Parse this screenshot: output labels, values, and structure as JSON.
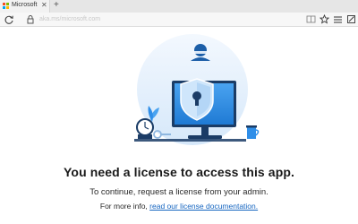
{
  "browser": {
    "tab_title": "Microsoft",
    "tab_close": "✕",
    "new_tab": "+",
    "url": "aka.ms/microsoft.com"
  },
  "icons": {
    "tab_favicon": "microsoft-logo",
    "refresh": "refresh-icon",
    "lock": "lock-icon",
    "reading_view": "reading-view-icon",
    "favorite": "star-icon",
    "hub": "hub-icon",
    "notes": "notes-icon"
  },
  "message": {
    "headline": "You need a license to access this app.",
    "subtext": "To continue, request a license from your admin.",
    "info_prefix": "For more info,",
    "info_link": "read our license documentation."
  },
  "colors": {
    "link": "#1565c0",
    "accent_blue": "#2f8ee8",
    "illustration_circle": "#e7f1fc"
  }
}
